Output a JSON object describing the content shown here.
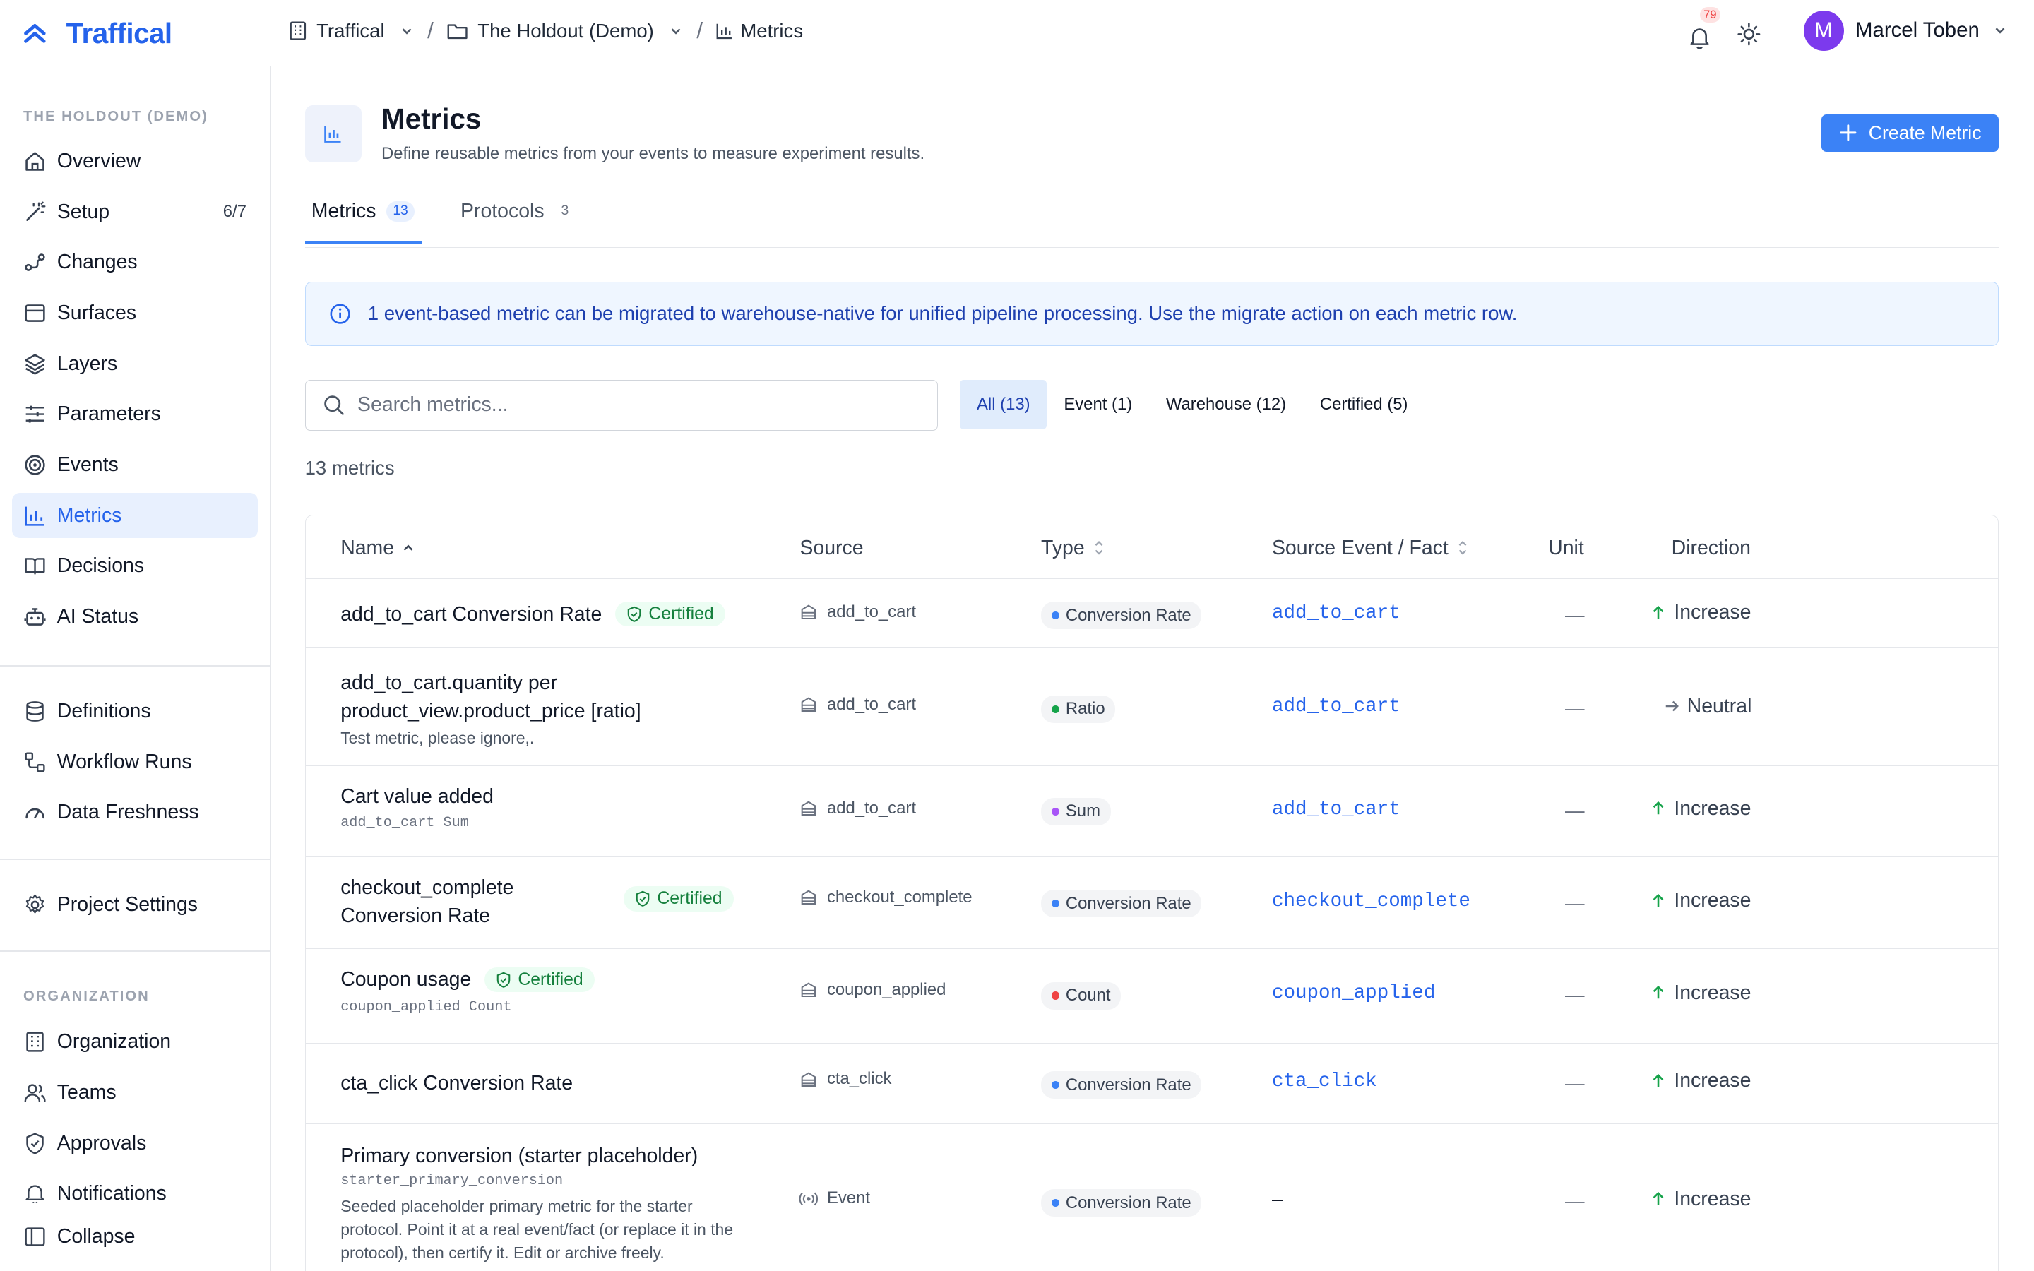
{
  "app": {
    "name": "Traffical"
  },
  "breadcrumb": [
    {
      "label": "Traffical",
      "icon": "building-icon"
    },
    {
      "label": "The Holdout (Demo)",
      "icon": "folder-icon"
    },
    {
      "label": "Metrics",
      "icon": "bar-chart-icon"
    }
  ],
  "notifications": {
    "count": "79"
  },
  "user": {
    "initial": "M",
    "name": "Marcel Toben"
  },
  "sidebar": {
    "project_label": "THE HOLDOUT (DEMO)",
    "items": [
      {
        "label": "Overview",
        "icon": "home-icon"
      },
      {
        "label": "Setup",
        "icon": "wand-icon",
        "count": "6/7"
      },
      {
        "label": "Changes",
        "icon": "changes-icon"
      },
      {
        "label": "Surfaces",
        "icon": "window-icon"
      },
      {
        "label": "Layers",
        "icon": "layers-icon"
      },
      {
        "label": "Parameters",
        "icon": "sliders-icon"
      },
      {
        "label": "Events",
        "icon": "target-icon"
      },
      {
        "label": "Metrics",
        "icon": "bar-chart-icon",
        "active": true
      },
      {
        "label": "Decisions",
        "icon": "book-icon"
      },
      {
        "label": "AI Status",
        "icon": "bot-icon"
      }
    ],
    "items2": [
      {
        "label": "Definitions",
        "icon": "database-icon"
      },
      {
        "label": "Workflow Runs",
        "icon": "workflow-icon"
      },
      {
        "label": "Data Freshness",
        "icon": "gauge-icon"
      }
    ],
    "items3": [
      {
        "label": "Project Settings",
        "icon": "gear-icon"
      }
    ],
    "org_label": "ORGANIZATION",
    "org_items": [
      {
        "label": "Organization",
        "icon": "building-icon"
      },
      {
        "label": "Teams",
        "icon": "users-icon"
      },
      {
        "label": "Approvals",
        "icon": "shield-check-icon"
      },
      {
        "label": "Notifications",
        "icon": "bell-icon"
      }
    ],
    "collapse_label": "Collapse"
  },
  "page": {
    "title": "Metrics",
    "subtitle": "Define reusable metrics from your events to measure experiment results.",
    "create_button": "Create Metric",
    "tabs": [
      {
        "label": "Metrics",
        "count": "13",
        "active": true
      },
      {
        "label": "Protocols",
        "count": "3"
      }
    ],
    "banner": "1 event-based metric can be migrated to warehouse-native for unified pipeline processing. Use the migrate action on each metric row.",
    "search_placeholder": "Search metrics...",
    "filters": [
      {
        "label": "All (13)",
        "active": true
      },
      {
        "label": "Event (1)"
      },
      {
        "label": "Warehouse (12)"
      },
      {
        "label": "Certified (5)"
      }
    ],
    "count_text": "13 metrics"
  },
  "table": {
    "columns": [
      "Name",
      "Source",
      "Type",
      "Source Event / Fact",
      "Unit",
      "Direction"
    ],
    "certified_label": "Certified",
    "rows": [
      {
        "name": "add_to_cart Conversion Rate",
        "certified": true,
        "source": "add_to_cart",
        "source_icon": "table-icon",
        "type": "Conversion Rate",
        "type_color": "#3b82f6",
        "event": "add_to_cart",
        "unit": "—",
        "direction": "Increase",
        "dir_icon": "arrow-up-icon"
      },
      {
        "name": "add_to_cart.quantity per product_view.product_price [ratio]",
        "desc": "Test metric, please ignore,.",
        "source": "add_to_cart",
        "source_icon": "table-icon",
        "type": "Ratio",
        "type_color": "#16a34a",
        "event": "add_to_cart",
        "unit": "—",
        "direction": "Neutral",
        "dir_icon": "arrow-right-icon"
      },
      {
        "name": "Cart value added",
        "sub": "add_to_cart Sum",
        "source": "add_to_cart",
        "source_icon": "table-icon",
        "type": "Sum",
        "type_color": "#a855f7",
        "event": "add_to_cart",
        "unit": "—",
        "direction": "Increase",
        "dir_icon": "arrow-up-icon"
      },
      {
        "name": "checkout_complete Conversion Rate",
        "certified": true,
        "source": "checkout_complete",
        "source_icon": "table-icon",
        "type": "Conversion Rate",
        "type_color": "#3b82f6",
        "event": "checkout_complete",
        "unit": "—",
        "direction": "Increase",
        "dir_icon": "arrow-up-icon"
      },
      {
        "name": "Coupon usage",
        "certified": true,
        "sub": "coupon_applied Count",
        "source": "coupon_applied",
        "source_icon": "table-icon",
        "type": "Count",
        "type_color": "#ef4444",
        "event": "coupon_applied",
        "unit": "—",
        "direction": "Increase",
        "dir_icon": "arrow-up-icon"
      },
      {
        "name": "cta_click Conversion Rate",
        "source": "cta_click",
        "source_icon": "table-icon",
        "type": "Conversion Rate",
        "type_color": "#3b82f6",
        "event": "cta_click",
        "unit": "—",
        "direction": "Increase",
        "dir_icon": "arrow-up-icon"
      },
      {
        "name": "Primary conversion (starter placeholder)",
        "sub": "starter_primary_conversion",
        "desc": "Seeded placeholder primary metric for the starter protocol. Point it at a real event/fact (or replace it in the protocol), then certify it. Edit or archive freely.",
        "source": "Event",
        "source_icon": "radio-icon",
        "type": "Conversion Rate",
        "type_color": "#3b82f6",
        "event": "–",
        "unit": "—",
        "direction": "Increase",
        "dir_icon": "arrow-up-icon"
      }
    ]
  }
}
